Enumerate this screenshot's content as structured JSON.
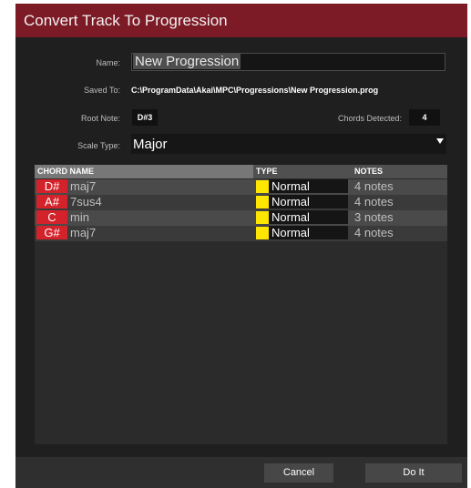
{
  "dialog": {
    "title": "Convert Track To Progression",
    "name_label": "Name:",
    "name_value": "New Progression",
    "saved_to_label": "Saved To:",
    "saved_to_value": "C:\\ProgramData\\Akai\\MPC\\Progressions\\New Progression.prog",
    "root_note_label": "Root Note:",
    "root_note_value": "D#3",
    "chords_detected_label": "Chords Detected:",
    "chords_detected_value": "4",
    "scale_type_label": "Scale Type:",
    "scale_type_value": "Major"
  },
  "table": {
    "headers": {
      "chord_name": "CHORD NAME",
      "type": "TYPE",
      "notes": "NOTES"
    },
    "rows": [
      {
        "root": "D#",
        "quality": "maj7",
        "type": "Normal",
        "notes": "4 notes"
      },
      {
        "root": "A#",
        "quality": "7sus4",
        "type": "Normal",
        "notes": "4 notes"
      },
      {
        "root": "C",
        "quality": "min",
        "type": "Normal",
        "notes": "3 notes"
      },
      {
        "root": "G#",
        "quality": "maj7",
        "type": "Normal",
        "notes": "4 notes"
      }
    ]
  },
  "footer": {
    "cancel_label": "Cancel",
    "do_it_label": "Do It"
  },
  "colors": {
    "title_bar": "#7c1a25",
    "root_badge": "#d4222a",
    "type_swatch": "#ffe600"
  },
  "icons": {
    "scale_dropdown": "chevron-down-icon",
    "type_swatch": "color-swatch"
  }
}
